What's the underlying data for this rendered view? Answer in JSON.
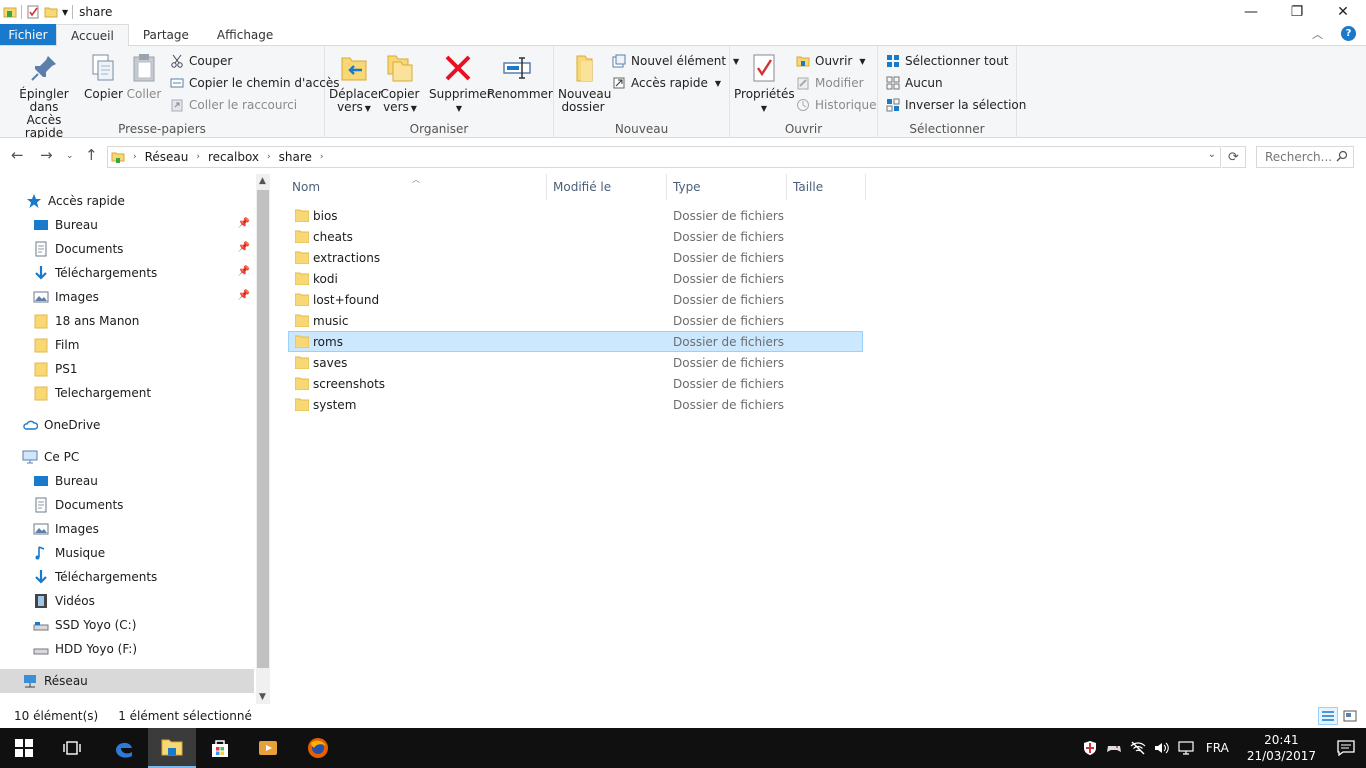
{
  "window": {
    "title": "share",
    "controls": {
      "minimize": "—",
      "maximize": "❐",
      "close": "✕"
    }
  },
  "ribbon_tabs": [
    "Fichier",
    "Accueil",
    "Partage",
    "Affichage"
  ],
  "ribbon": {
    "clipboard": {
      "label": "Presse-papiers",
      "pin_line1": "Épingler dans",
      "pin_line2": "Accès rapide",
      "copy": "Copier",
      "paste": "Coller",
      "cut": "Couper",
      "copy_path": "Copier le chemin d'accès",
      "paste_shortcut": "Coller le raccourci"
    },
    "organize": {
      "label": "Organiser",
      "move_line1": "Déplacer",
      "move_line2": "vers",
      "copy_line1": "Copier",
      "copy_line2": "vers",
      "delete": "Supprimer",
      "rename": "Renommer"
    },
    "new": {
      "label": "Nouveau",
      "folder_line1": "Nouveau",
      "folder_line2": "dossier",
      "new_item": "Nouvel élément",
      "quick_access": "Accès rapide"
    },
    "open": {
      "label": "Ouvrir",
      "properties": "Propriétés",
      "open": "Ouvrir",
      "edit": "Modifier",
      "history": "Historique"
    },
    "select": {
      "label": "Sélectionner",
      "select_all": "Sélectionner tout",
      "none": "Aucun",
      "invert": "Inverser la sélection"
    }
  },
  "address": {
    "crumbs": [
      "Réseau",
      "recalbox",
      "share"
    ],
    "search_placeholder": "Recherch..."
  },
  "nav_pane": {
    "quick_access": "Accès rapide",
    "quick_items": [
      "Bureau",
      "Documents",
      "Téléchargements",
      "Images",
      "18 ans Manon",
      "Film",
      "PS1",
      "Telechargement"
    ],
    "onedrive": "OneDrive",
    "this_pc": "Ce PC",
    "pc_items": [
      "Bureau",
      "Documents",
      "Images",
      "Musique",
      "Téléchargements",
      "Vidéos",
      "SSD Yoyo (C:)",
      "HDD Yoyo (F:)"
    ],
    "network": "Réseau"
  },
  "columns": [
    "Nom",
    "Modifié le",
    "Type",
    "Taille"
  ],
  "files": [
    {
      "name": "bios",
      "type": "Dossier de fichiers"
    },
    {
      "name": "cheats",
      "type": "Dossier de fichiers"
    },
    {
      "name": "extractions",
      "type": "Dossier de fichiers"
    },
    {
      "name": "kodi",
      "type": "Dossier de fichiers"
    },
    {
      "name": "lost+found",
      "type": "Dossier de fichiers"
    },
    {
      "name": "music",
      "type": "Dossier de fichiers"
    },
    {
      "name": "roms",
      "type": "Dossier de fichiers"
    },
    {
      "name": "saves",
      "type": "Dossier de fichiers"
    },
    {
      "name": "screenshots",
      "type": "Dossier de fichiers"
    },
    {
      "name": "system",
      "type": "Dossier de fichiers"
    }
  ],
  "selected_file": "roms",
  "status": {
    "count": "10 élément(s)",
    "selected": "1 élément sélectionné"
  },
  "taskbar": {
    "language": "FRA",
    "time": "20:41",
    "date": "21/03/2017"
  },
  "colors": {
    "accent": "#1979ca",
    "selection": "#cce8ff",
    "folder": "#f8d775"
  }
}
